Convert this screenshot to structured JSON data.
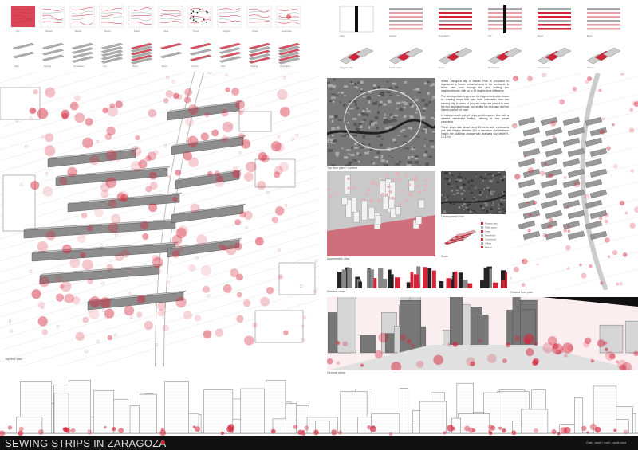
{
  "board": {
    "title": "SEWING STRIPS IN ZARAGOZA",
    "footer_note": "East - west + north - south sect.",
    "accent": "#d4243a"
  },
  "captions": {
    "top_floor_plan": "Top floor plan",
    "top_floor_context": "Top floor plan + Context",
    "axonometric_view": "Axonometric view",
    "development_plan": "Development plan",
    "scale": "Scale",
    "massing_views": "Massive views",
    "ground_floor_plan": "Ground floor plan",
    "general_views": "General views"
  },
  "description": [
    "Within Zaragoza city a Master Plan is proposed to regenerate a former industrial area in the northwest. A linear park runs through the plot, knitting two neighbourhoods, with up to 10 heights level difference.",
    "The developed strategy sews the fragmented urban tissue by drawing strips that take their orientation from the existing city. A series of program strips are placed to sew the two neighbourhoods, connecting the new park and the historic part of the town.",
    "In between each pair of strips, public spaces flow with a marked residential feeling, offering a rich visual panorama.",
    "These strips take shape as a 10-metre-wide continuous plot, with heights between 300 m maximum and minimum height; the buildings change with changing sky, depth 9-12-15 m."
  ],
  "diagram_labels": [
    "Program strip",
    "Public space",
    "Green",
    "Residential",
    "Commercial",
    "Offices",
    "Parking"
  ],
  "icon_rows": {
    "row1_labels": [
      "City",
      "Streets",
      "Blocks",
      "Rivers",
      "Parks",
      "Axes",
      "Trees",
      "Heights",
      "Views",
      "Landmark"
    ],
    "strip_labels": [
      "Strip",
      "Sewing",
      "Orientation",
      "Cut",
      "Rows",
      "Bend",
      "Curves"
    ]
  }
}
